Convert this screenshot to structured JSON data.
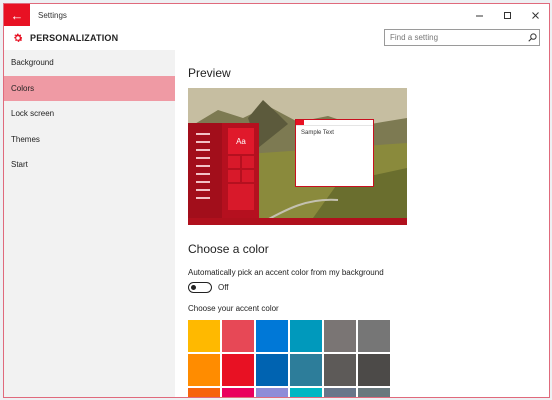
{
  "window": {
    "title": "Settings"
  },
  "header": {
    "title": "PERSONALIZATION"
  },
  "search": {
    "placeholder": "Find a setting"
  },
  "sidebar": {
    "items": [
      {
        "label": "Background",
        "active": false
      },
      {
        "label": "Colors",
        "active": true
      },
      {
        "label": "Lock screen",
        "active": false
      },
      {
        "label": "Themes",
        "active": false
      },
      {
        "label": "Start",
        "active": false
      }
    ]
  },
  "main": {
    "preview_title": "Preview",
    "preview": {
      "sample_text": "Sample Text",
      "tile_text": "Aa"
    },
    "choose_color_title": "Choose a color",
    "auto_accent_label": "Automatically pick an accent color from my background",
    "toggle_state": "Off",
    "accent_label": "Choose your accent color"
  },
  "colors": {
    "accent": "#e81123",
    "swatches": [
      "#ffb900",
      "#e74856",
      "#0078d7",
      "#0099bc",
      "#7a7574",
      "#767676",
      "#ff8c00",
      "#e81123",
      "#0063b1",
      "#2d7d9a",
      "#5d5a58",
      "#4c4a48",
      "#f7630c",
      "#ea005e",
      "#8e8cd8",
      "#00b7c3",
      "#68768a",
      "#69797e"
    ]
  }
}
